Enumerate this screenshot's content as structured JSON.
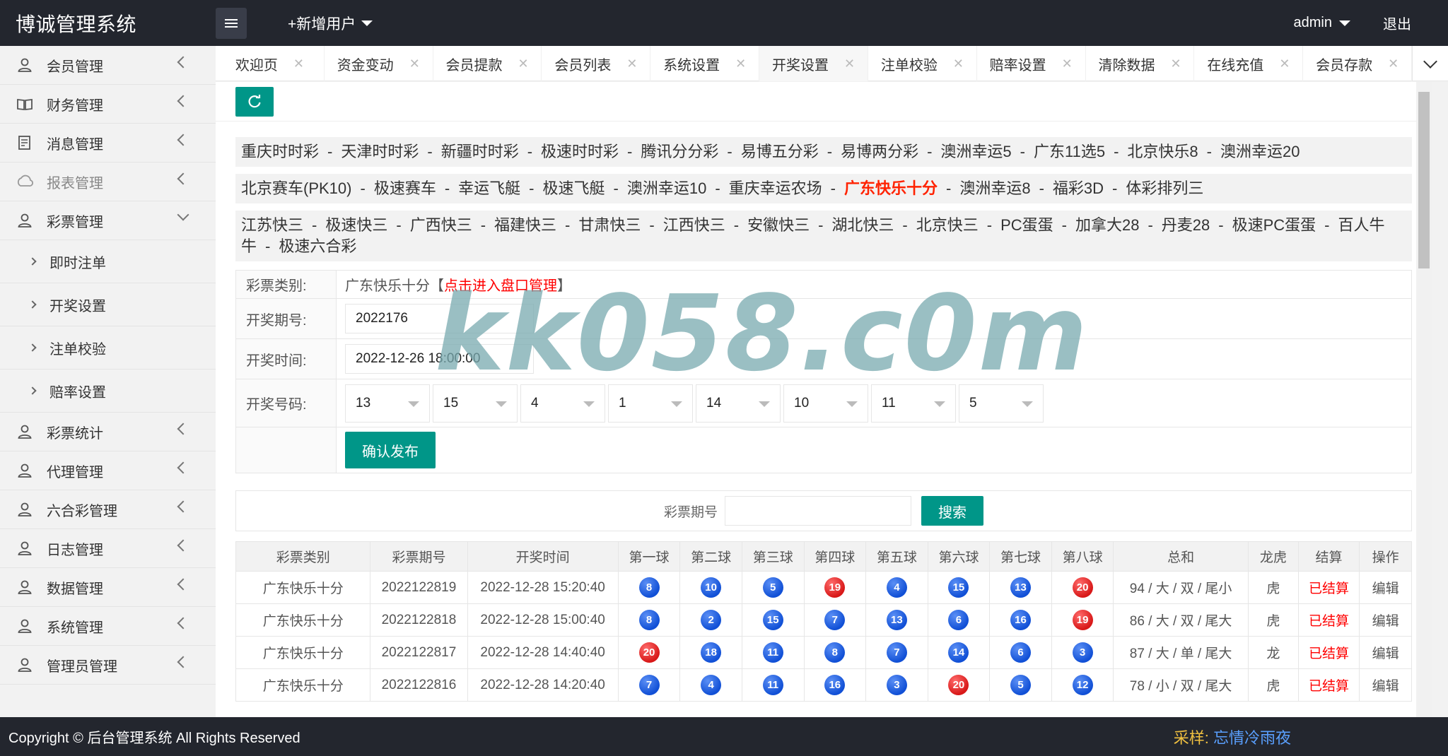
{
  "app": {
    "title": "博诚管理系统",
    "add_user": "+新增用户",
    "user": "admin",
    "logout": "退出"
  },
  "sidebar": {
    "items": [
      {
        "label": "会员管理",
        "icon": "user-icon"
      },
      {
        "label": "财务管理",
        "icon": "book-icon"
      },
      {
        "label": "消息管理",
        "icon": "message-icon"
      },
      {
        "label": "报表管理",
        "icon": "report-icon"
      },
      {
        "label": "彩票管理",
        "icon": "user-icon",
        "expanded": true
      }
    ],
    "sub_items": [
      "即时注单",
      "开奖设置",
      "注单校验",
      "赔率设置"
    ],
    "items_after": [
      {
        "label": "彩票统计"
      },
      {
        "label": "代理管理"
      },
      {
        "label": "六合彩管理"
      },
      {
        "label": "日志管理"
      },
      {
        "label": "数据管理"
      },
      {
        "label": "系统管理"
      },
      {
        "label": "管理员管理"
      }
    ]
  },
  "tabs": [
    "欢迎页",
    "资金变动",
    "会员提款",
    "会员列表",
    "系统设置",
    "开奖设置",
    "注单校验",
    "赔率设置",
    "清除数据",
    "在线充值",
    "会员存款"
  ],
  "active_tab": "开奖设置",
  "lottery_rows": [
    [
      "重庆时时彩",
      "天津时时彩",
      "新疆时时彩",
      "极速时时彩",
      "腾讯分分彩",
      "易博五分彩",
      "易博两分彩",
      "澳洲幸运5",
      "广东11选5",
      "北京快乐8",
      "澳洲幸运20"
    ],
    [
      "北京赛车(PK10)",
      "极速赛车",
      "幸运飞艇",
      "极速飞艇",
      "澳洲幸运10",
      "重庆幸运农场",
      "广东快乐十分",
      "澳洲幸运8",
      "福彩3D",
      "体彩排列三"
    ],
    [
      "江苏快三",
      "极速快三",
      "广西快三",
      "福建快三",
      "甘肃快三",
      "江西快三",
      "安徽快三",
      "湖北快三",
      "北京快三",
      "PC蛋蛋",
      "加拿大28",
      "丹麦28",
      "极速PC蛋蛋",
      "百人牛牛",
      "极速六合彩"
    ]
  ],
  "highlight_lottery": "广东快乐十分",
  "form": {
    "type_label": "彩票类别:",
    "type_value": "广东快乐十分",
    "type_link_open": "【",
    "type_link": "点击进入盘口管理",
    "type_link_close": "】",
    "period_label": "开奖期号:",
    "period_value": "2022176",
    "time_label": "开奖时间:",
    "time_value": "2022-12-26 18:00:00",
    "numbers_label": "开奖号码:",
    "numbers": [
      "13",
      "15",
      "4",
      "1",
      "14",
      "10",
      "11",
      "5"
    ],
    "submit": "确认发布"
  },
  "search": {
    "label": "彩票期号",
    "button": "搜索"
  },
  "table": {
    "headers": [
      "彩票类别",
      "彩票期号",
      "开奖时间",
      "第一球",
      "第二球",
      "第三球",
      "第四球",
      "第五球",
      "第六球",
      "第七球",
      "第八球",
      "总和",
      "龙虎",
      "结算",
      "操作"
    ],
    "rows": [
      {
        "type": "广东快乐十分",
        "period": "2022122819",
        "time": "2022-12-28 15:20:40",
        "balls": [
          8,
          10,
          5,
          19,
          4,
          15,
          13,
          20
        ],
        "sum": "94 / 大 / 双 / 尾小",
        "dragon": "虎",
        "status": "已结算",
        "action": "编辑"
      },
      {
        "type": "广东快乐十分",
        "period": "2022122818",
        "time": "2022-12-28 15:00:40",
        "balls": [
          8,
          2,
          15,
          7,
          13,
          6,
          16,
          19
        ],
        "sum": "86 / 大 / 双 / 尾大",
        "dragon": "虎",
        "status": "已结算",
        "action": "编辑"
      },
      {
        "type": "广东快乐十分",
        "period": "2022122817",
        "time": "2022-12-28 14:40:40",
        "balls": [
          20,
          18,
          11,
          8,
          7,
          14,
          6,
          3
        ],
        "sum": "87 / 大 / 单 / 尾大",
        "dragon": "龙",
        "status": "已结算",
        "action": "编辑"
      },
      {
        "type": "广东快乐十分",
        "period": "2022122816",
        "time": "2022-12-28 14:20:40",
        "balls": [
          7,
          4,
          11,
          16,
          3,
          20,
          5,
          12
        ],
        "sum": "78 / 小 / 双 / 尾大",
        "dragon": "虎",
        "status": "已结算",
        "action": "编辑"
      }
    ]
  },
  "footer": {
    "copyright": "Copyright © 后台管理系统 All Rights Reserved",
    "credit_label": "采样:",
    "credit_name": "忘情冷雨夜"
  },
  "watermark": "kk058.c0m",
  "colors": {
    "accent": "#009688",
    "topbar": "#23262e",
    "ball_blue": "#1150d6",
    "ball_red": "#d81818",
    "highlight": "#ff2200"
  }
}
